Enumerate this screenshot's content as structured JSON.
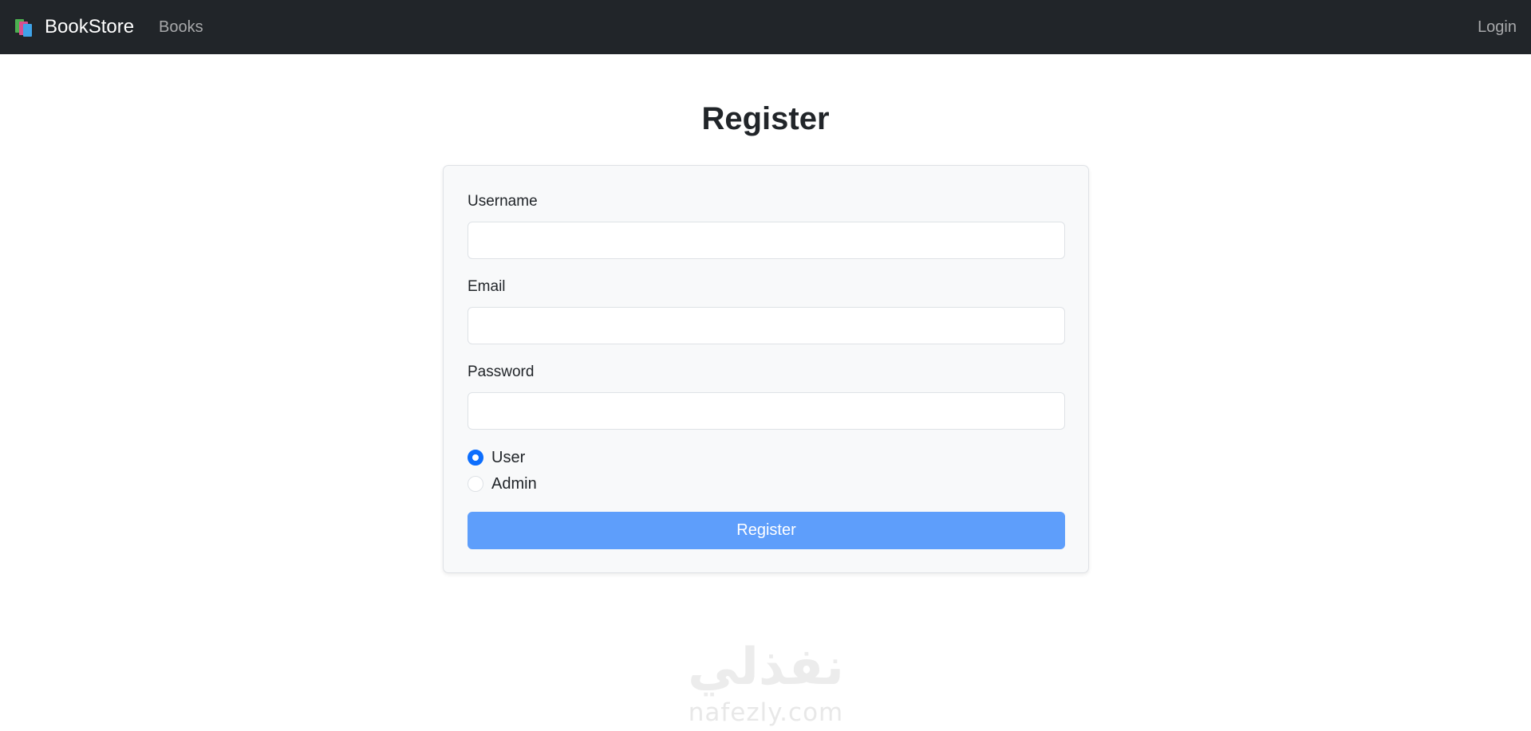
{
  "navbar": {
    "brand_icon": "books-icon",
    "brand_label": "BookStore",
    "nav_books": "Books",
    "nav_login": "Login",
    "background": "#212529"
  },
  "page": {
    "title": "Register"
  },
  "form": {
    "username_label": "Username",
    "username_value": "",
    "email_label": "Email",
    "email_value": "",
    "password_label": "Password",
    "password_value": "",
    "role_options": [
      {
        "label": "User",
        "selected": true
      },
      {
        "label": "Admin",
        "selected": false
      }
    ],
    "submit_label": "Register",
    "submit_color": "#5e9efb"
  },
  "watermark": {
    "arabic": "نفذلي",
    "latin": "nafezly.com"
  }
}
